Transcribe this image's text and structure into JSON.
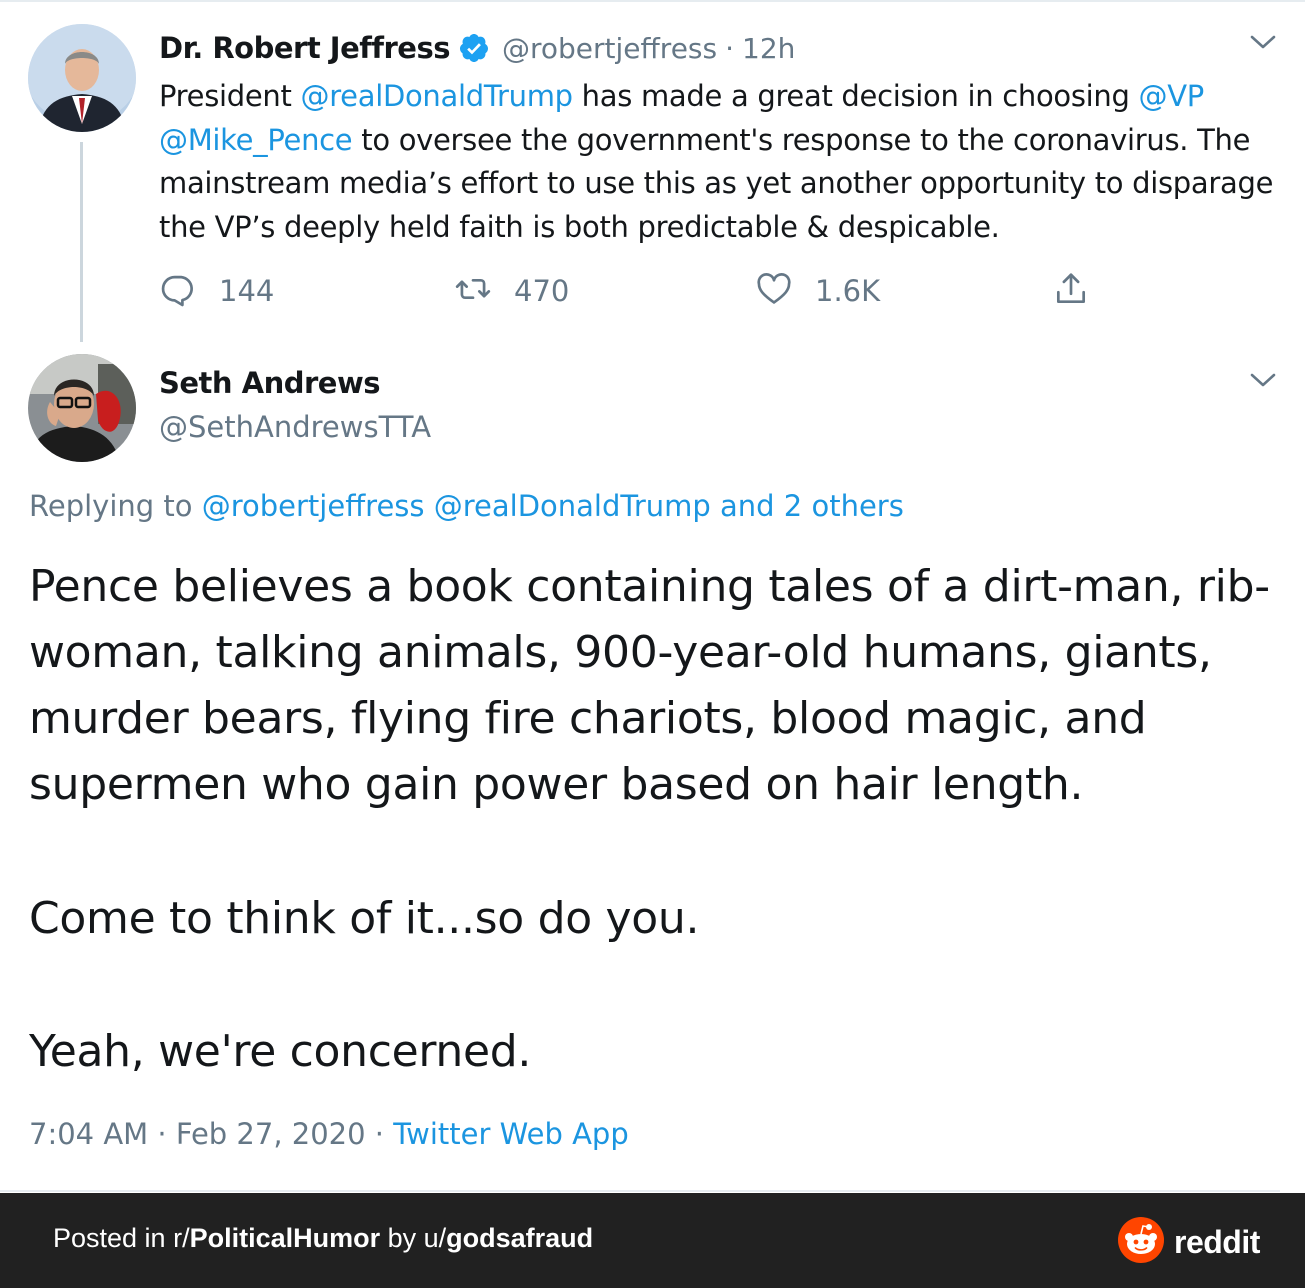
{
  "tweet1": {
    "name": "Dr. Robert Jeffress",
    "handle": "@robertjeffress",
    "separator": "·",
    "time": "12h",
    "text_parts": [
      {
        "text": "President ",
        "mention": false
      },
      {
        "text": "@realDonaldTrump",
        "mention": true
      },
      {
        "text": " has made a great decision in choosing ",
        "mention": false
      },
      {
        "text": "@VP",
        "mention": true
      },
      {
        "text": " ",
        "mention": false
      },
      {
        "text": "@Mike_Pence",
        "mention": true
      },
      {
        "text": " to oversee the government's response to the coronavirus. The mainstream media’s effort to use this as yet another opportunity to disparage the VP’s deeply held faith is both predictable & despicable.",
        "mention": false
      }
    ],
    "replies": "144",
    "retweets": "470",
    "likes": "1.6K"
  },
  "tweet2": {
    "name": "Seth Andrews",
    "handle": "@SethAndrewsTTA",
    "replying_label": "Replying to ",
    "replying_mentions": "@robertjeffress @realDonaldTrump and 2 others",
    "para1": "Pence believes a book containing tales of a dirt-man, rib-woman, talking animals, 900-year-old humans, giants, murder bears, flying fire chariots, blood magic, and supermen who gain power based on hair length.",
    "para2": "Come to think of it...so do you.",
    "para3": "Yeah, we're concerned.",
    "timestamp": "7:04 AM · Feb 27, 2020 · ",
    "app": "Twitter Web App"
  },
  "footer": {
    "posted_in": "Posted in r/",
    "subreddit": "PoliticalHumor",
    "by": " by u/",
    "user": "godsafraud",
    "brand": "reddit"
  },
  "colors": {
    "link": "#1b95e0",
    "muted": "#657786",
    "footer_bg": "#212121",
    "reddit_orange": "#ff4500"
  },
  "icons": [
    "verified-badge-icon",
    "chevron-down-icon",
    "reply-icon",
    "retweet-icon",
    "like-icon",
    "share-icon",
    "reddit-snoo-icon"
  ]
}
